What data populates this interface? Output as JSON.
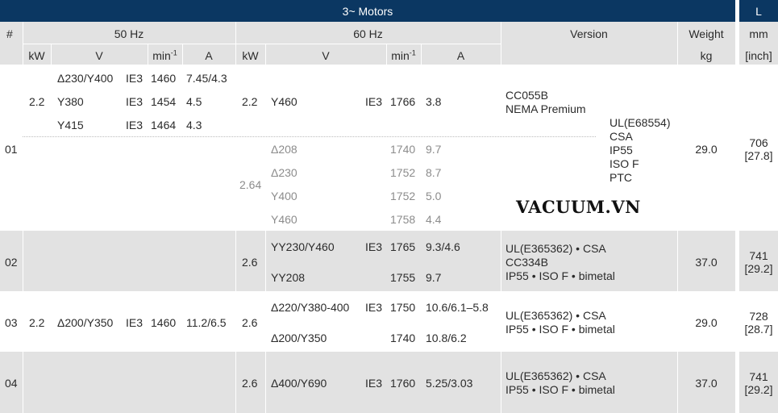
{
  "header": {
    "title": "3~ Motors",
    "l_label": "L",
    "hash": "#",
    "hz50": "50 Hz",
    "hz60": "60 Hz",
    "version": "Version",
    "weight": "Weight",
    "mm": "mm",
    "kw_50": "kW",
    "v_50": "V",
    "min_50": "min",
    "min_sup": "-1",
    "a_50": "A",
    "kw_60": "kW",
    "v_60": "V",
    "min_60": "min",
    "a_60": "A",
    "kg": "kg",
    "inch": "[inch]"
  },
  "rows": [
    {
      "id": "01",
      "kw50": "2.2",
      "v50": [
        "Δ230/Y400",
        "Y380",
        "Y415"
      ],
      "ie50": [
        "IE3",
        "IE3",
        "IE3"
      ],
      "min50": [
        "1460",
        "1454",
        "1464"
      ],
      "a50": [
        "7.45/4.3",
        "4.5",
        "4.3"
      ],
      "kw60": [
        "2.2",
        "2.64"
      ],
      "v60": [
        "Y460",
        "Δ208",
        "Δ230",
        "Y400",
        "Y460"
      ],
      "ie60": [
        "IE3"
      ],
      "min60": [
        "1766",
        "1740",
        "1752",
        "1752",
        "1758"
      ],
      "a60": [
        "3.8",
        "9.7",
        "8.7",
        "5.0",
        "4.4"
      ],
      "version_a": [
        "CC055B",
        "NEMA Premium"
      ],
      "version_b": [
        "UL(E68554)",
        "CSA",
        "IP55",
        "ISO F",
        "PTC"
      ],
      "weight": "29.0",
      "l_mm": "706",
      "l_inch": "[27.8]"
    },
    {
      "id": "02",
      "kw60": "2.6",
      "v60": [
        "YY230/Y460",
        "YY208"
      ],
      "ie60": "IE3",
      "min60": [
        "1765",
        "1755"
      ],
      "a60": [
        "9.3/4.6",
        "9.7"
      ],
      "version": [
        "UL(E365362) • CSA",
        "CC334B",
        "IP55 • ISO F • bimetal"
      ],
      "weight": "37.0",
      "l_mm": "741",
      "l_inch": "[29.2]"
    },
    {
      "id": "03",
      "kw50": "2.2",
      "v50": "Δ200/Y350",
      "ie50": "IE3",
      "min50": "1460",
      "a50": "11.2/6.5",
      "kw60": "2.6",
      "v60": [
        "Δ220/Y380-400",
        "Δ200/Y350"
      ],
      "ie60": "IE3",
      "min60": [
        "1750",
        "1740"
      ],
      "a60": [
        "10.6/6.1–5.8",
        "10.8/6.2"
      ],
      "version": [
        "UL(E365362) • CSA",
        "IP55 • ISO F • bimetal"
      ],
      "weight": "29.0",
      "l_mm": "728",
      "l_inch": "[28.7]"
    },
    {
      "id": "04",
      "kw60": "2.6",
      "v60": "Δ400/Y690",
      "ie60": "IE3",
      "min60": "1760",
      "a60": "5.25/3.03",
      "version": [
        "UL(E365362) • CSA",
        "IP55 • ISO F • bimetal"
      ],
      "weight": "37.0",
      "l_mm": "741",
      "l_inch": "[29.2]"
    }
  ],
  "watermark": "VACUUM.VN"
}
